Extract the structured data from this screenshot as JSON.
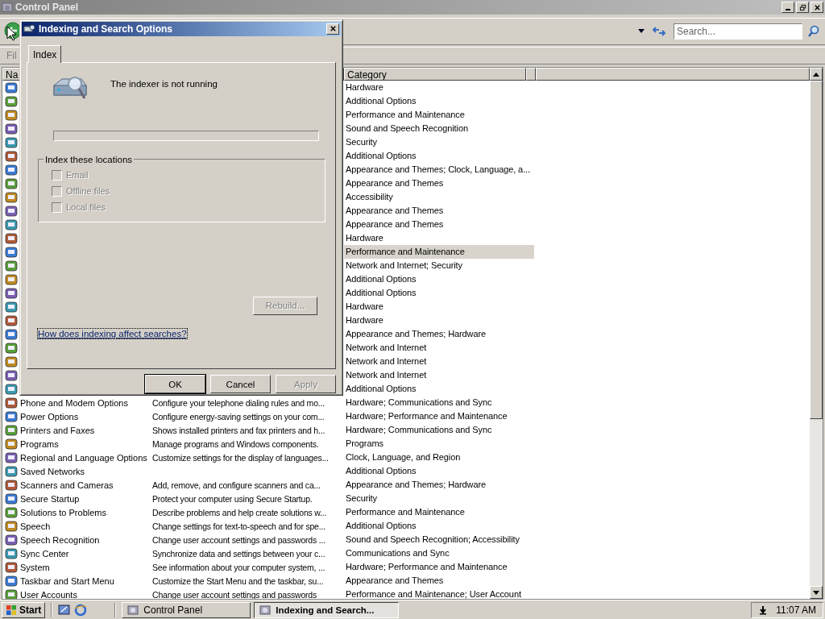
{
  "window": {
    "title": "Control Panel"
  },
  "toolbar": {
    "search": {
      "placeholder": "Search..."
    }
  },
  "menu_bar": {
    "items": [
      "Fil"
    ]
  },
  "list": {
    "columns": {
      "name": "Na",
      "category": "Category"
    },
    "rows": [
      {
        "category": "Hardware",
        "selected": false
      },
      {
        "category": "Additional Options",
        "selected": false
      },
      {
        "category": "Performance and Maintenance",
        "selected": false
      },
      {
        "category": "Sound and Speech Recognition",
        "selected": false
      },
      {
        "category": "Security",
        "selected": false
      },
      {
        "category": "Additional Options",
        "selected": false
      },
      {
        "category": "Appearance and Themes; Clock, Language, a...",
        "selected": false
      },
      {
        "category": "Appearance and Themes",
        "selected": false
      },
      {
        "category": "Accessibility",
        "selected": false
      },
      {
        "category": "Appearance and Themes",
        "selected": false
      },
      {
        "category": "Appearance and Themes",
        "selected": false
      },
      {
        "category": "Hardware",
        "selected": false
      },
      {
        "category": "Performance and Maintenance",
        "selected": true
      },
      {
        "category": "Network and Internet; Security",
        "selected": false
      },
      {
        "category": "Additional Options",
        "selected": false
      },
      {
        "category": "Additional Options",
        "selected": false
      },
      {
        "category": "Hardware",
        "selected": false
      },
      {
        "category": "Hardware",
        "selected": false
      },
      {
        "category": "Appearance and Themes; Hardware",
        "selected": false
      },
      {
        "category": "Network and Internet",
        "selected": false
      },
      {
        "category": "Network and Internet",
        "selected": false
      },
      {
        "category": "Network and Internet",
        "selected": false
      },
      {
        "category": "Additional Options",
        "selected": false
      },
      {
        "name": "Phone and Modem Options",
        "description": "Configure your telephone dialing rules and mo...",
        "category": "Hardware; Communications and Sync",
        "selected": false
      },
      {
        "name": "Power Options",
        "description": "Configure energy-saving settings on your com...",
        "category": "Hardware; Performance and Maintenance",
        "selected": false
      },
      {
        "name": "Printers and Faxes",
        "description": "Shows installed printers and fax printers and h...",
        "category": "Hardware; Communications and Sync",
        "selected": false
      },
      {
        "name": "Programs",
        "description": "Manage programs and Windows components.",
        "category": "Programs",
        "selected": false
      },
      {
        "name": "Regional and Language Options",
        "description": "Customize settings for the display of languages...",
        "category": "Clock, Language, and Region",
        "selected": false
      },
      {
        "name": "Saved Networks",
        "category": "Additional Options",
        "selected": false
      },
      {
        "name": "Scanners and Cameras",
        "description": "Add, remove, and configure scanners and ca...",
        "category": "Appearance and Themes; Hardware",
        "selected": false
      },
      {
        "name": "Secure Startup",
        "description": "Protect your computer using Secure Startup.",
        "category": "Security",
        "selected": false
      },
      {
        "name": "Solutions to Problems",
        "description": "Describe problems and help create solutions w...",
        "category": "Performance and Maintenance",
        "selected": false
      },
      {
        "name": "Speech",
        "description": "Change settings for text-to-speech and for spe...",
        "category": "Additional Options",
        "selected": false
      },
      {
        "name": "Speech Recognition",
        "description": "Change user account settings and passwords ...",
        "category": "Sound and Speech Recognition; Accessibility",
        "selected": false
      },
      {
        "name": "Sync Center",
        "description": "Synchronize data and settings between your c...",
        "category": "Communications and Sync",
        "selected": false
      },
      {
        "name": "System",
        "description": "See information about your computer system, ...",
        "category": "Hardware; Performance and Maintenance",
        "selected": false
      },
      {
        "name": "Taskbar and Start Menu",
        "description": "Customize the Start Menu and the taskbar, su...",
        "category": "Appearance and Themes",
        "selected": false
      },
      {
        "name": "User Accounts",
        "description": "Change user account settings and passwords",
        "category": "Performance and Maintenance; User Account",
        "selected": false
      }
    ]
  },
  "dialog": {
    "title": "Indexing and Search Options",
    "tabs": [
      {
        "label": "Index",
        "selected": true
      }
    ],
    "status": "The indexer is not running",
    "progress": {
      "level": 0
    },
    "group": {
      "title": "Index these locations",
      "options": [
        {
          "label": "Email",
          "checked": false,
          "disabled": true
        },
        {
          "label": "Offline files",
          "checked": false,
          "disabled": true
        },
        {
          "label": "Local files",
          "checked": false,
          "disabled": true
        }
      ]
    },
    "rebuild_button": {
      "label": "Rebuild...",
      "disabled": true
    },
    "help_link": "How does indexing affect searches?",
    "buttons": [
      {
        "label": "OK",
        "disabled": false
      },
      {
        "label": "Cancel",
        "disabled": false
      },
      {
        "label": "Apply",
        "disabled": true
      }
    ]
  },
  "taskbar": {
    "start": "Start",
    "tasks": [
      {
        "label": "Control Panel",
        "selected": false
      },
      {
        "label": "Indexing and Search...",
        "selected": true
      }
    ],
    "clock": "11:07 AM"
  }
}
